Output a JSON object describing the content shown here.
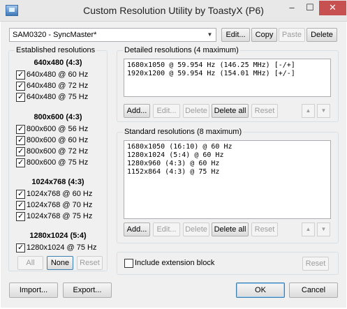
{
  "window": {
    "title": "Custom Resolution Utility by ToastyX (P6)",
    "min_glyph": "–",
    "max_glyph": "☐",
    "close_glyph": "✕"
  },
  "toolbar": {
    "monitor_value": "SAM0320 - SyncMaster*",
    "edit_label": "Edit...",
    "copy_label": "Copy",
    "paste_label": "Paste",
    "delete_label": "Delete"
  },
  "established": {
    "title": "Established resolutions",
    "groups": [
      {
        "header": "640x480 (4:3)",
        "items": [
          {
            "label": "640x480 @ 60 Hz",
            "checked": true
          },
          {
            "label": "640x480 @ 72 Hz",
            "checked": true
          },
          {
            "label": "640x480 @ 75 Hz",
            "checked": true
          }
        ]
      },
      {
        "header": "800x600 (4:3)",
        "items": [
          {
            "label": "800x600 @ 56 Hz",
            "checked": true
          },
          {
            "label": "800x600 @ 60 Hz",
            "checked": true
          },
          {
            "label": "800x600 @ 72 Hz",
            "checked": true
          },
          {
            "label": "800x600 @ 75 Hz",
            "checked": true
          }
        ]
      },
      {
        "header": "1024x768 (4:3)",
        "items": [
          {
            "label": "1024x768 @ 60 Hz",
            "checked": true
          },
          {
            "label": "1024x768 @ 70 Hz",
            "checked": true
          },
          {
            "label": "1024x768 @ 75 Hz",
            "checked": true
          }
        ]
      },
      {
        "header": "1280x1024 (5:4)",
        "items": [
          {
            "label": "1280x1024 @ 75 Hz",
            "checked": true
          }
        ]
      }
    ],
    "all_label": "All",
    "none_label": "None",
    "reset_label": "Reset"
  },
  "detailed": {
    "title": "Detailed resolutions (4 maximum)",
    "rows": [
      "1680x1050 @ 59.954 Hz (146.25 MHz) [-/+]",
      "1920x1200 @ 59.954 Hz (154.01 MHz) [+/-]"
    ],
    "add_label": "Add...",
    "edit_label": "Edit...",
    "delete_label": "Delete",
    "delete_all_label": "Delete all",
    "reset_label": "Reset",
    "up_icon": "▲",
    "down_icon": "▼"
  },
  "standard": {
    "title": "Standard resolutions (8 maximum)",
    "rows": [
      "1680x1050 (16:10) @ 60 Hz",
      "1280x1024 (5:4) @ 60 Hz",
      "1280x960 (4:3) @ 60 Hz",
      "1152x864 (4:3) @ 75 Hz"
    ],
    "add_label": "Add...",
    "edit_label": "Edit...",
    "delete_label": "Delete",
    "delete_all_label": "Delete all",
    "reset_label": "Reset",
    "up_icon": "▲",
    "down_icon": "▼"
  },
  "extension": {
    "label": "Include extension block",
    "checked": false,
    "reset_label": "Reset"
  },
  "footer": {
    "import_label": "Import...",
    "export_label": "Export...",
    "ok_label": "OK",
    "cancel_label": "Cancel"
  },
  "colors": {
    "close_button": "#c75050",
    "focus_border": "#3c7fb1"
  }
}
